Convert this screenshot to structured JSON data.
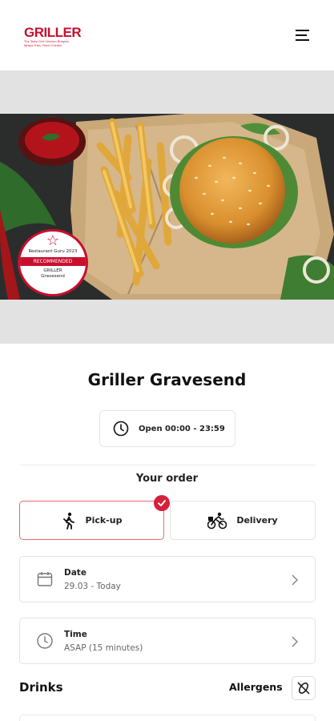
{
  "header": {
    "logo_text": "GRILLER",
    "logo_tagline_1": "The Tasty Grill Chicken Burgers",
    "logo_tagline_2": "Wraps Fries, Fried Chicken",
    "menu_icon": "hamburger-menu-icon"
  },
  "hero": {
    "badge_line1": "Restaurant Guru 2023",
    "badge_line2": "RECOMMENDED",
    "badge_line3": "GRILLER",
    "badge_line4": "Gravesend"
  },
  "restaurant": {
    "name": "Griller Gravesend",
    "hours": "Open 00:00 - 23:59"
  },
  "order": {
    "title": "Your order",
    "modes": [
      {
        "label": "Pick-up",
        "icon": "walking-person-icon",
        "selected": true
      },
      {
        "label": "Delivery",
        "icon": "cyclist-icon",
        "selected": false
      }
    ],
    "date": {
      "label": "Date",
      "value": "29.03 - Today",
      "icon": "calendar-icon"
    },
    "time": {
      "label": "Time",
      "value": "ASAP (15 minutes)",
      "icon": "clock-icon"
    }
  },
  "menu_section": {
    "title": "Drinks",
    "allergens_label": "Allergens",
    "allergens_icon": "no-allergens-icon"
  },
  "colors": {
    "brand_red": "#c8102e",
    "selected_border": "#e86a6a",
    "badge_red": "#d61f3a",
    "band_gray": "#e2e2e2"
  }
}
